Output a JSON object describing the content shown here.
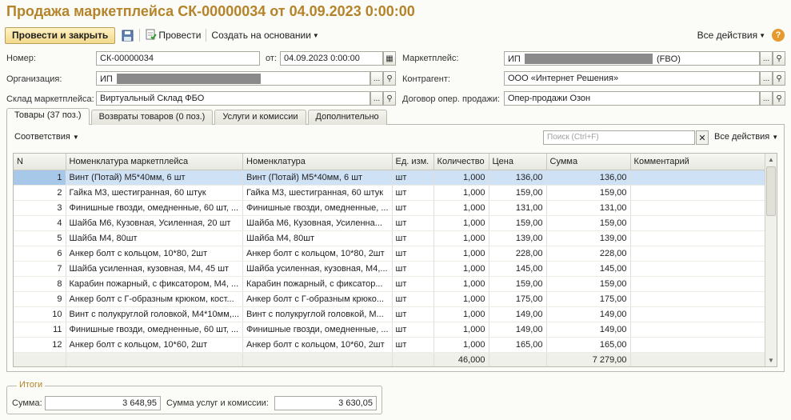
{
  "title": "Продажа маркетплейса СК-00000034 от 04.09.2023 0:00:00",
  "toolbar": {
    "post_close": "Провести и закрыть",
    "post": "Провести",
    "create_based": "Создать на основании",
    "all_actions": "Все действия",
    "help": "?"
  },
  "form": {
    "number_label": "Номер:",
    "number": "СК-00000034",
    "date_label": "от:",
    "date": "04.09.2023  0:00:00",
    "marketplace_label": "Маркетплейс:",
    "marketplace_prefix": "ИП",
    "marketplace_suffix": "(FBO)",
    "org_label": "Организация:",
    "org_prefix": "ИП",
    "counterparty_label": "Контрагент:",
    "counterparty": "ООО «Интернет Решения»",
    "warehouse_label": "Склад маркетплейса:",
    "warehouse": "Виртуальный Склад ФБО",
    "contract_label": "Договор опер. продажи:",
    "contract": "Опер-продажи Озон",
    "ellipsis": "...",
    "search_glyph": "⚲"
  },
  "tabs": [
    {
      "label": "Товары (37 поз.)"
    },
    {
      "label": "Возвраты товаров (0 поз.)"
    },
    {
      "label": "Услуги и комиссии"
    },
    {
      "label": "Дополнительно"
    }
  ],
  "subtoolbar": {
    "correspondence": "Соответствия",
    "search_placeholder": "Поиск (Ctrl+F)",
    "all_actions": "Все действия"
  },
  "table": {
    "columns": [
      "N",
      "Номенклатура маркетплейса",
      "Номенклатура",
      "Ед. изм.",
      "Количество",
      "Цена",
      "Сумма",
      "Комментарий"
    ],
    "rows": [
      [
        "1",
        "Винт (Потай) М5*40мм, 6 шт",
        "Винт (Потай) М5*40мм, 6 шт",
        "шт",
        "1,000",
        "136,00",
        "136,00",
        ""
      ],
      [
        "2",
        "Гайка М3, шестигранная, 60 штук",
        "Гайка М3, шестигранная, 60 штук",
        "шт",
        "1,000",
        "159,00",
        "159,00",
        ""
      ],
      [
        "3",
        "Финишные гвозди, омедненные, 60 шт, ...",
        "Финишные гвозди, омедненные, ...",
        "шт",
        "1,000",
        "131,00",
        "131,00",
        ""
      ],
      [
        "4",
        "Шайба М6, Кузовная, Усиленная, 20 шт",
        "Шайба М6, Кузовная, Усиленна...",
        "шт",
        "1,000",
        "159,00",
        "159,00",
        ""
      ],
      [
        "5",
        "Шайба  М4, 80шт",
        "Шайба  М4, 80шт",
        "шт",
        "1,000",
        "139,00",
        "139,00",
        ""
      ],
      [
        "6",
        "Анкер болт с кольцом, 10*80, 2шт",
        "Анкер болт с кольцом, 10*80, 2шт",
        "шт",
        "1,000",
        "228,00",
        "228,00",
        ""
      ],
      [
        "7",
        "Шайба усиленная, кузовная, М4, 45 шт",
        "Шайба усиленная, кузовная, М4,...",
        "шт",
        "1,000",
        "145,00",
        "145,00",
        ""
      ],
      [
        "8",
        "Карабин пожарный, с фиксатором, М4, ...",
        "Карабин пожарный, с фиксатор...",
        "шт",
        "1,000",
        "159,00",
        "159,00",
        ""
      ],
      [
        "9",
        "Анкер болт с Г-образным крюком, кост...",
        "Анкер болт с Г-образным крюко...",
        "шт",
        "1,000",
        "175,00",
        "175,00",
        ""
      ],
      [
        "10",
        "Винт с полукруглой головкой, М4*10мм,...",
        "Винт с полукруглой головкой, М...",
        "шт",
        "1,000",
        "149,00",
        "149,00",
        ""
      ],
      [
        "11",
        "Финишные гвозди, омедненные, 60 шт, ...",
        "Финишные гвозди, омедненные, ...",
        "шт",
        "1,000",
        "149,00",
        "149,00",
        ""
      ],
      [
        "12",
        "Анкер болт с кольцом, 10*60, 2шт",
        "Анкер болт с кольцом, 10*60, 2шт",
        "шт",
        "1,000",
        "165,00",
        "165,00",
        ""
      ]
    ],
    "footer": {
      "quantity": "46,000",
      "sum": "7 279,00"
    }
  },
  "totals": {
    "legend": "Итоги",
    "sum_label": "Сумма:",
    "sum": "3 648,95",
    "services_label": "Сумма услуг и комиссии:",
    "services": "3 630,05"
  },
  "colors": {
    "title": "#b5842a",
    "selection": "#cfe2f5",
    "help": "#e59a2b"
  }
}
